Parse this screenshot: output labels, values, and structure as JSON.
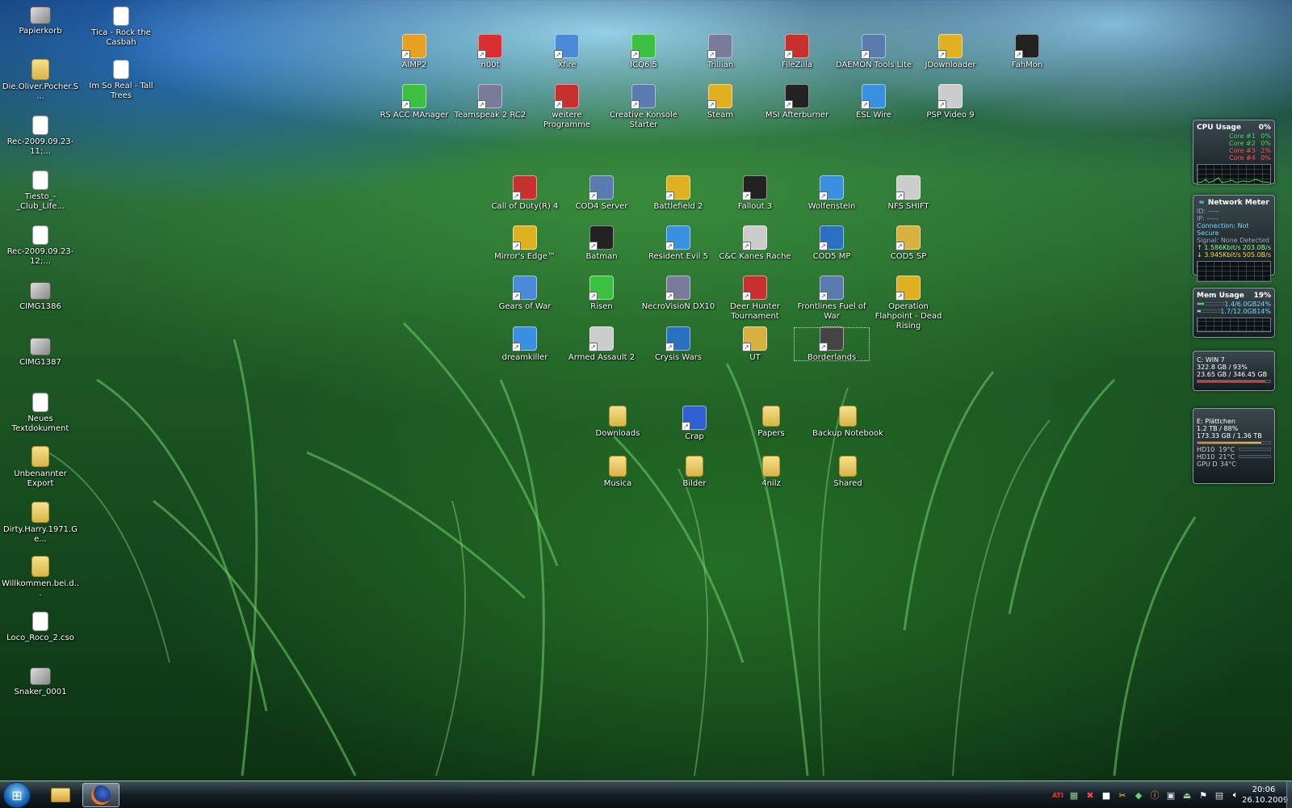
{
  "desktop": {
    "left_column": [
      {
        "label": "Papierkorb",
        "icon": "recycle-bin-icon"
      },
      {
        "label": "Die.Oliver.Pocher.S...",
        "icon": "folder-icon"
      },
      {
        "label": "Rec-2009.09.23-11;...",
        "icon": "audio-file-icon"
      },
      {
        "label": "Tiesto_-_Club_Life...",
        "icon": "audio-file-icon"
      },
      {
        "label": "Rec-2009.09.23-12;...",
        "icon": "audio-file-icon"
      },
      {
        "label": "CIMG1386",
        "icon": "video-file-icon"
      },
      {
        "label": "CIMG1387",
        "icon": "video-file-icon"
      },
      {
        "label": "Neues Textdokument",
        "icon": "text-file-icon"
      },
      {
        "label": "Unbenannter Export",
        "icon": "folder-icon"
      },
      {
        "label": "Dirty.Harry.1971.Ge...",
        "icon": "folder-icon"
      },
      {
        "label": "Willkommen.bei.d...",
        "icon": "folder-icon"
      },
      {
        "label": "Loco_Roco_2.cso",
        "icon": "file-icon"
      },
      {
        "label": "Snaker_0001",
        "icon": "image-file-icon"
      }
    ],
    "second_column": [
      {
        "label": "Tica - Rock the Casbah",
        "icon": "audio-file-icon"
      },
      {
        "label": "Im So Real - Tall Trees",
        "icon": "audio-file-icon"
      }
    ],
    "apps_row1": [
      "AIMP2",
      "n00t",
      "Xfire",
      "ICQ6.5",
      "Trillian",
      "FileZilla",
      "DAEMON Tools Lite",
      "JDownloader",
      "FahMon"
    ],
    "apps_row2": [
      "RS ACC MAnager",
      "Teamspeak 2 RC2",
      "weitere Programme",
      "Creative Konsole Starter",
      "Steam",
      "MSI Afterburner",
      "ESL Wire",
      "PSP Video 9"
    ],
    "games_row1": [
      "Call of Duty(R) 4",
      "COD4 Server",
      "Battlefield 2",
      "Fallout 3",
      "Wolfenstein",
      "NFS SHIFT"
    ],
    "games_row2": [
      "Mirror's Edge™",
      "Batman",
      "Resident Evil 5",
      "C&C Kanes Rache",
      "COD5 MP",
      "COD5 SP"
    ],
    "games_row3": [
      "Gears of War",
      "Risen",
      "NecroVisioN DX10",
      "Deer Hunter Tournament",
      "Frontlines Fuel of War",
      "Operation Flahpoint - Dead Rising"
    ],
    "games_row4": [
      "dreamkiller",
      "Armed Assault 2",
      "Crysis Wars",
      "UT",
      "Borderlands"
    ],
    "folders_row1": [
      "Downloads",
      "Crap",
      "Papers",
      "Backup Notebook"
    ],
    "folders_row2": [
      "Musica",
      "Bilder",
      "4nilz",
      "Shared"
    ]
  },
  "gadgets": {
    "cpu": {
      "title": "CPU Usage",
      "value": "0%",
      "cores": [
        {
          "label": "Core #1",
          "value": "0%",
          "color": "#35e04a"
        },
        {
          "label": "Core #2",
          "value": "0%",
          "color": "#35e04a"
        },
        {
          "label": "Core #3",
          "value": "2%",
          "color": "#ff5050"
        },
        {
          "label": "Core #4",
          "value": "0%",
          "color": "#ff5050"
        }
      ]
    },
    "network": {
      "title": "Network Meter",
      "ip1": "ID: -----",
      "ip2": "IP: -----",
      "connection": "Connection: Not Secure",
      "signal": "Signal: None Detected",
      "up": "1.586Kbit/s",
      "up_total": "203.0B/s",
      "down": "3.945Kbit/s",
      "down_total": "505.0B/s"
    },
    "mem": {
      "title": "Mem Usage",
      "value": "19%",
      "row1": "1.4/6.0GB",
      "row1_pct": "24%",
      "row2": "1.7/12.0GB",
      "row2_pct": "14%"
    },
    "drive_c": {
      "line1": "C: WIN 7",
      "line2": "322.8 GB / 93%",
      "line3": "23.65 GB / 346.45 GB"
    },
    "drive_e": {
      "line1": "E: Plättchen",
      "line2": "1.2 TB / 88%",
      "line3": "173.33 GB / 1.36 TB",
      "temps": [
        {
          "label": "HD10",
          "value": "19°C"
        },
        {
          "label": "HD10",
          "value": "21°C"
        },
        {
          "label": "GPU D",
          "value": "34°C"
        }
      ]
    }
  },
  "taskbar": {
    "clock_time": "20:06",
    "clock_date": "26.10.2009"
  }
}
